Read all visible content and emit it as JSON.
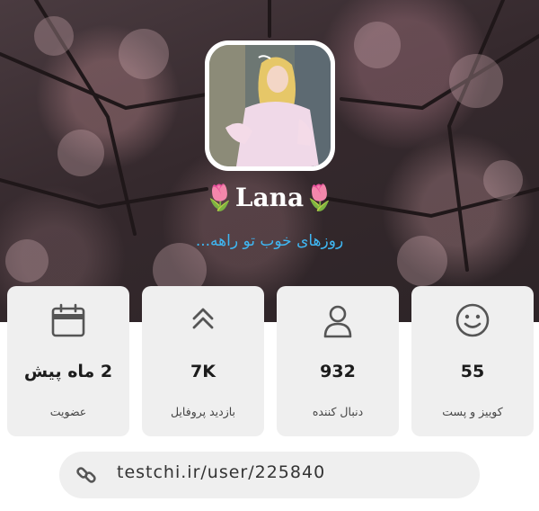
{
  "profile": {
    "name": "🌷Lana🌷",
    "bio": "روزهای خوب تو راهه..."
  },
  "stats": [
    {
      "icon": "smiley-icon",
      "value": "55",
      "label": "کوییز و پست"
    },
    {
      "icon": "user-icon",
      "value": "932",
      "label": "دنبال کننده"
    },
    {
      "icon": "chevrons-up-icon",
      "value": "7K",
      "label": "بازدید پروفایل"
    },
    {
      "icon": "calendar-icon",
      "value": "2 ماه پیش",
      "label": "عضویت"
    }
  ],
  "link": {
    "icon": "link-icon",
    "url": "testchi.ir/user/225840"
  },
  "colors": {
    "bio": "#3fb7f3",
    "card_background": "#efefef",
    "icon": "#555555"
  }
}
